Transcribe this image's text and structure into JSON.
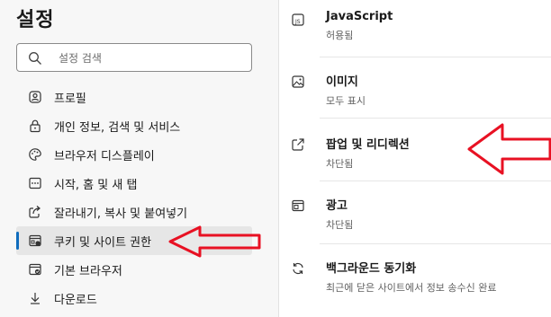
{
  "settings": {
    "title": "설정",
    "search_placeholder": "설정 검색"
  },
  "sidebar": {
    "items": [
      {
        "label": "프로필",
        "icon": "profile-icon"
      },
      {
        "label": "개인 정보, 검색 및 서비스",
        "icon": "lock-icon"
      },
      {
        "label": "브라우저 디스플레이",
        "icon": "palette-icon"
      },
      {
        "label": "시작, 홈 및 새 탭",
        "icon": "home-tab-icon"
      },
      {
        "label": "잘라내기, 복사 및 붙여넣기",
        "icon": "share-icon"
      },
      {
        "label": "쿠키 및 사이트 권한",
        "icon": "site-permissions-icon",
        "active": true
      },
      {
        "label": "기본 브라우저",
        "icon": "browser-icon"
      },
      {
        "label": "다운로드",
        "icon": "download-icon"
      }
    ]
  },
  "permissions": [
    {
      "title": "JavaScript",
      "subtitle": "허용됨",
      "icon": "javascript-icon"
    },
    {
      "title": "이미지",
      "subtitle": "모두 표시",
      "icon": "image-icon"
    },
    {
      "title": "팝업 및 리디렉션",
      "subtitle": "차단됨",
      "icon": "popup-icon"
    },
    {
      "title": "광고",
      "subtitle": "차단됨",
      "icon": "ads-icon"
    },
    {
      "title": "백그라운드 동기화",
      "subtitle": "최근에 닫은 사이트에서 정보 송수신 완료",
      "icon": "sync-icon"
    }
  ],
  "colors": {
    "accent": "#0f6cbd",
    "annotation_arrow": "#e81123"
  }
}
